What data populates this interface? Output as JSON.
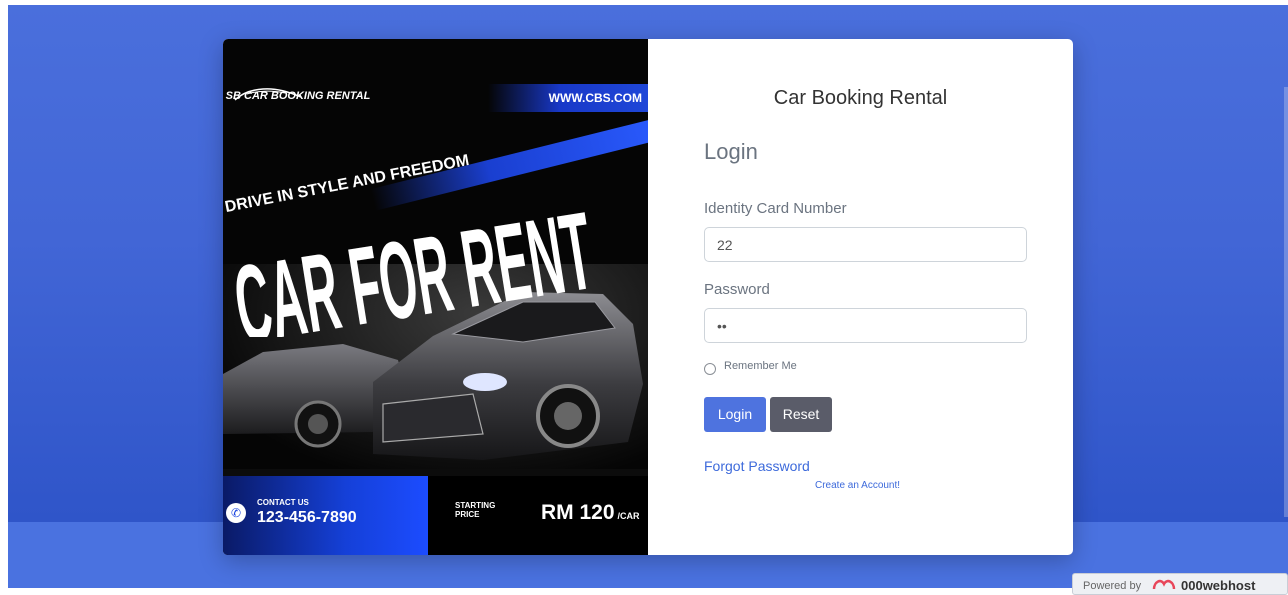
{
  "poster": {
    "brand": "SB CAR BOOKING RENTAL",
    "website": "WWW.CBS.COM",
    "tagline": "DRIVE IN STYLE AND FREEDOM",
    "headline": "CAR FOR RENT",
    "contact_label": "CONTACT US",
    "contact_phone": "123-456-7890",
    "starting_label": "STARTING PRICE",
    "price": "RM 120",
    "price_unit": "/CAR"
  },
  "form": {
    "app_title": "Car Booking Rental",
    "heading": "Login",
    "ic_label": "Identity Card Number",
    "ic_value": "22",
    "password_label": "Password",
    "password_value": "••",
    "remember_label": "Remember Me",
    "login_button": "Login",
    "reset_button": "Reset",
    "forgot_link": "Forgot Password",
    "create_link": "Create an Account!"
  },
  "badge": {
    "prefix": "Powered by",
    "name": "000webhost"
  },
  "colors": {
    "background": "#4266d6",
    "primary": "#4e73df",
    "secondary": "#5a5c69",
    "link": "#3d6adb",
    "poster_accent": "#1c4cff"
  },
  "icons": [
    "phone-icon",
    "car-silhouette-icon",
    "webhost-logo-icon"
  ]
}
